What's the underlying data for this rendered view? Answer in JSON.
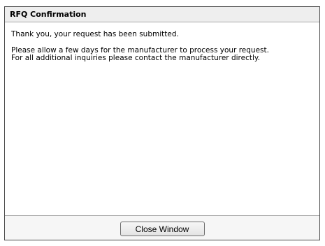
{
  "dialog": {
    "title": "RFQ Confirmation"
  },
  "message": {
    "thanks": "Thank you, your request has been submitted.",
    "line1": "Please allow a few days for the manufacturer to process your request.",
    "line2": "For all additional inquiries please contact the manufacturer directly."
  },
  "footer": {
    "close_label": "Close Window"
  }
}
